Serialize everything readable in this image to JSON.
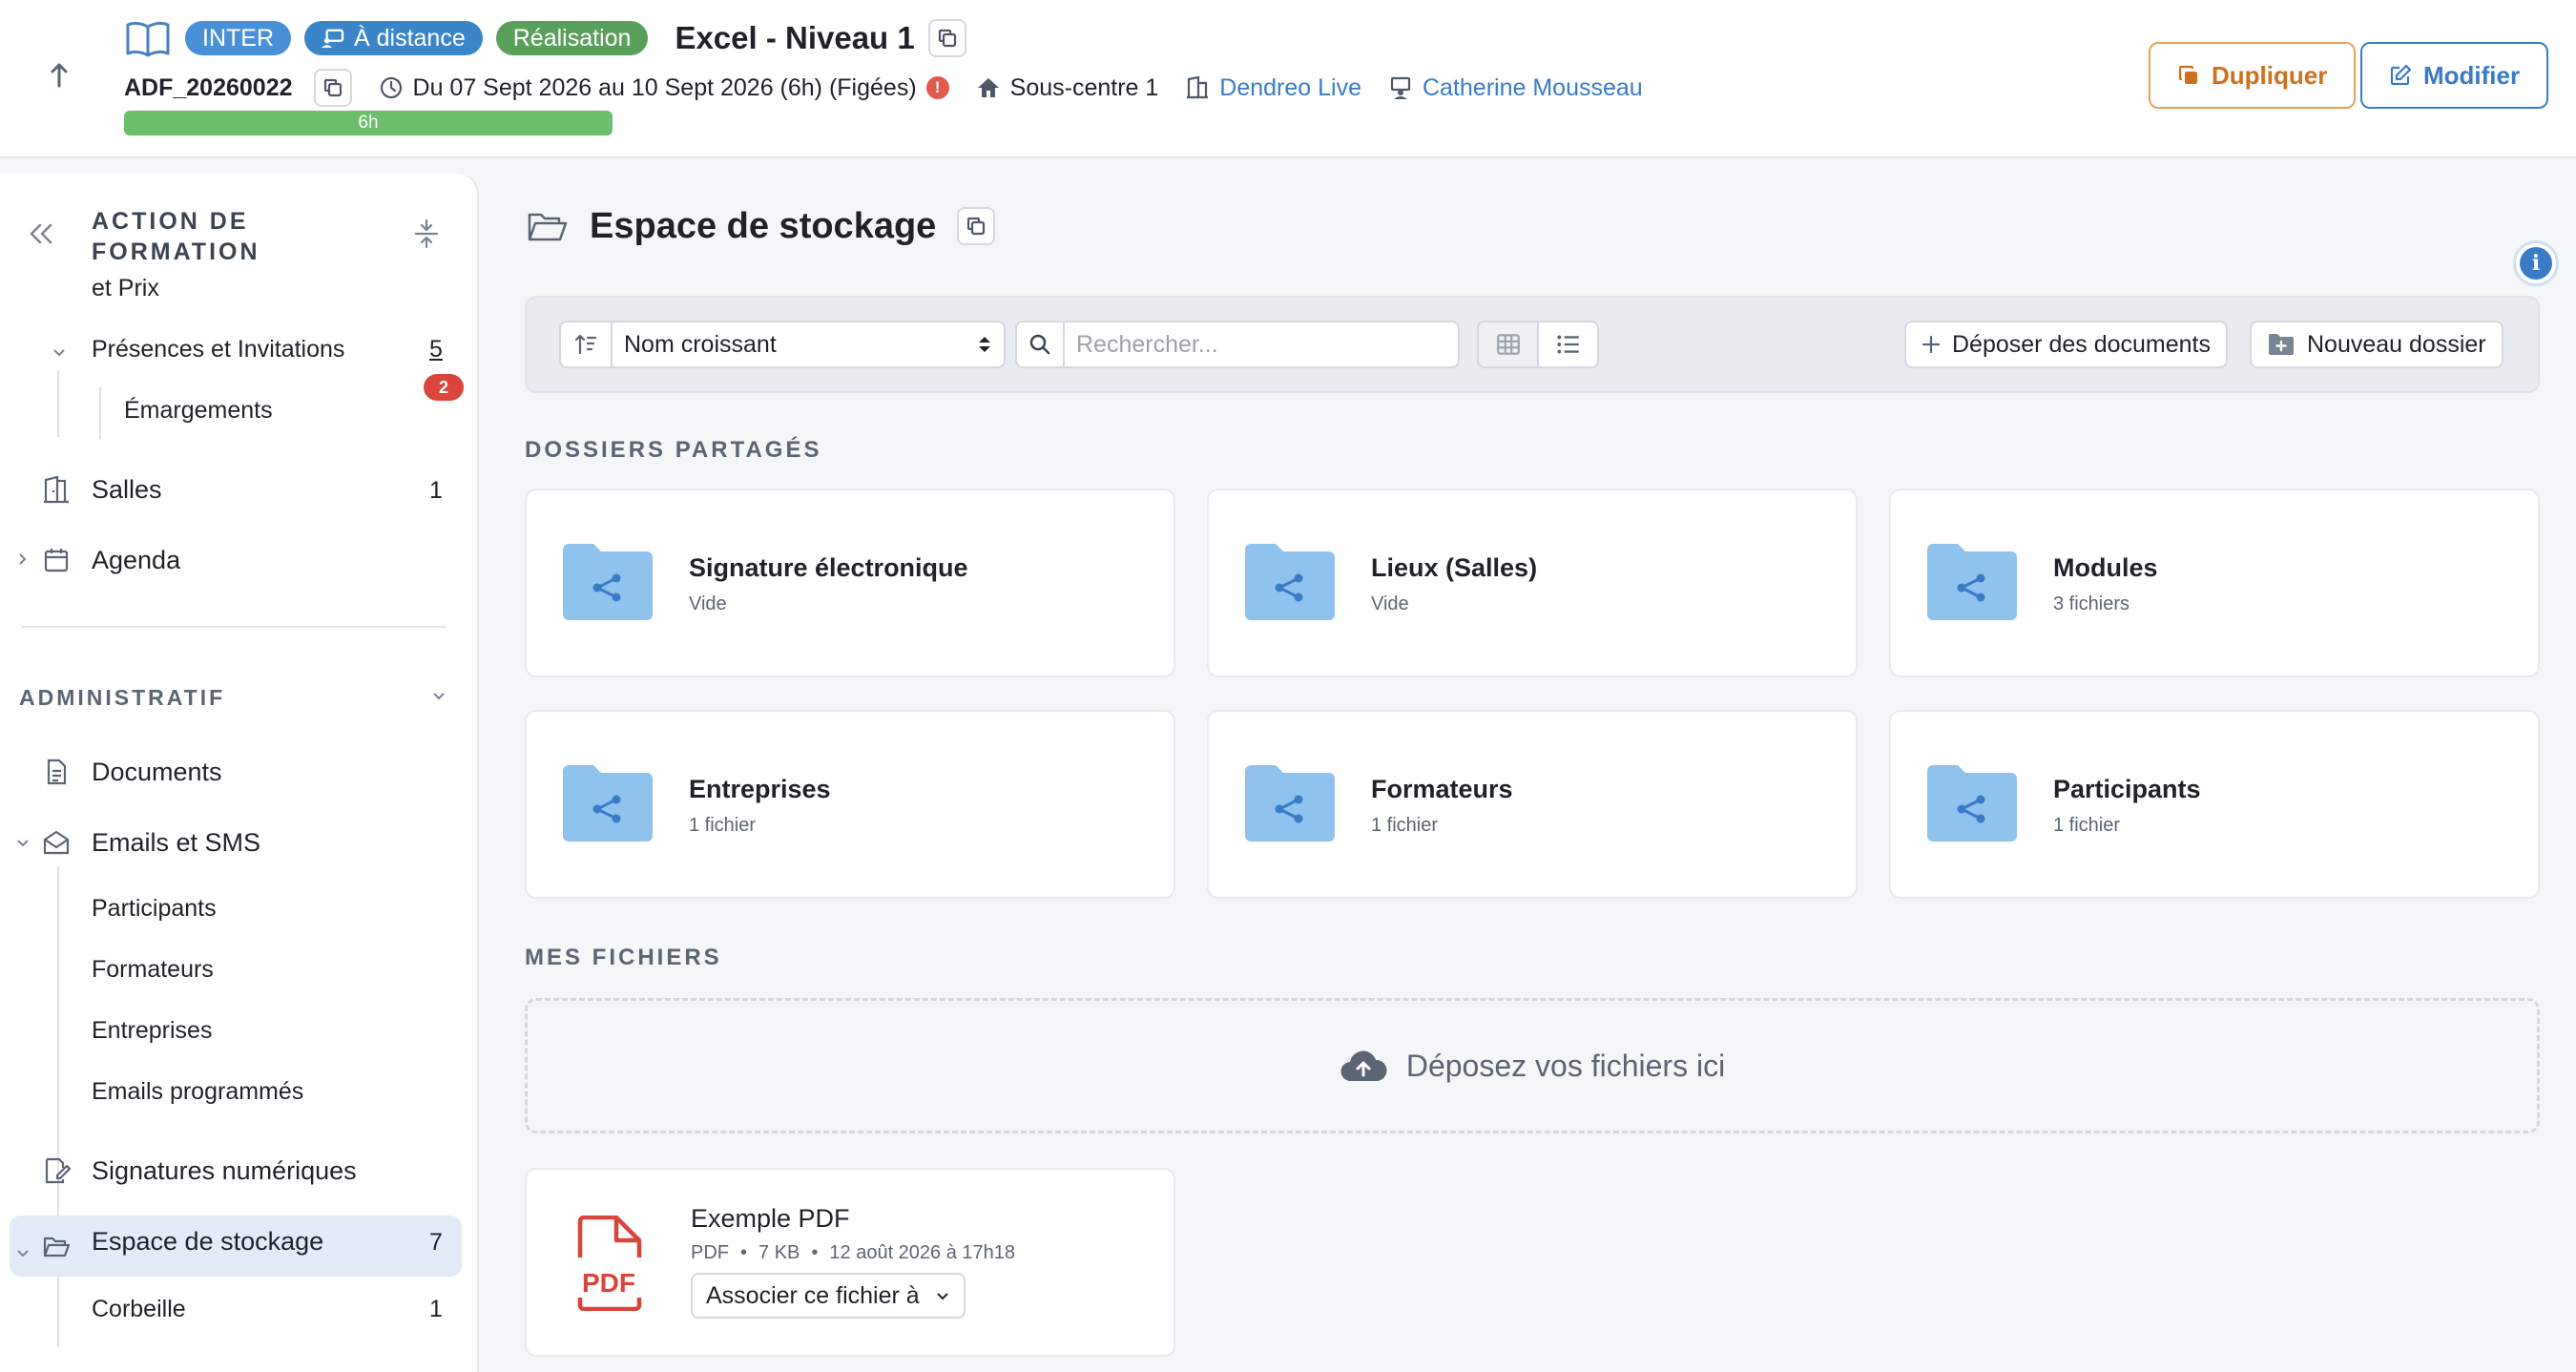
{
  "header": {
    "tag_inter": "INTER",
    "tag_distance": "À distance",
    "tag_realisation": "Réalisation",
    "title": "Excel - Niveau 1",
    "code": "ADF_20260022",
    "dates": "Du 07 Sept 2026 au 10 Sept 2026 (6h) (Figées)",
    "location": "Sous-centre 1",
    "organisation": "Dendreo Live",
    "person": "Catherine Mousseau",
    "progress_label": "6h",
    "progress_fraction": 1.0,
    "btn_duplicate": "Dupliquer",
    "btn_edit": "Modifier",
    "colors": {
      "inter": "#4a90d9",
      "distance": "#3a86c8",
      "realisation": "#5aa05a",
      "duplicate": "#d0701d",
      "edit": "#3a7bc8"
    }
  },
  "sidebar": {
    "section_title": "ACTION DE FORMATION",
    "items": {
      "prix_partial": "et Prix",
      "presences": "Présences et Invitations",
      "presences_count": "5",
      "emargements": "Émargements",
      "emargements_badge": "2",
      "salles": "Salles",
      "salles_count": "1",
      "agenda": "Agenda"
    },
    "admin_title": "ADMINISTRATIF",
    "admin": {
      "documents": "Documents",
      "emails": "Emails et SMS",
      "participants": "Participants",
      "formateurs": "Formateurs",
      "entreprises": "Entreprises",
      "emails_programmes": "Emails programmés",
      "signatures": "Signatures numériques",
      "stockage": "Espace de stockage",
      "stockage_count": "7",
      "corbeille": "Corbeille",
      "corbeille_count": "1"
    }
  },
  "main": {
    "title": "Espace de stockage",
    "sort_label": "Nom croissant",
    "search_placeholder": "Rechercher...",
    "btn_deposer": "Déposer des documents",
    "btn_nouveau": "Nouveau dossier",
    "shared_label": "DOSSIERS PARTAGÉS",
    "folders": [
      {
        "name": "Signature électronique",
        "sub": "Vide"
      },
      {
        "name": "Lieux (Salles)",
        "sub": "Vide"
      },
      {
        "name": "Modules",
        "sub": "3 fichiers"
      },
      {
        "name": "Entreprises",
        "sub": "1 fichier"
      },
      {
        "name": "Formateurs",
        "sub": "1 fichier"
      },
      {
        "name": "Participants",
        "sub": "1 fichier"
      }
    ],
    "my_files_label": "MES FICHIERS",
    "dropzone": "Déposez vos fichiers ici",
    "file": {
      "name": "Exemple PDF",
      "type": "PDF",
      "size": "7 KB",
      "date": "12 août 2026 à 17h18",
      "assoc": "Associer ce fichier à",
      "icon_text": "PDF"
    }
  }
}
